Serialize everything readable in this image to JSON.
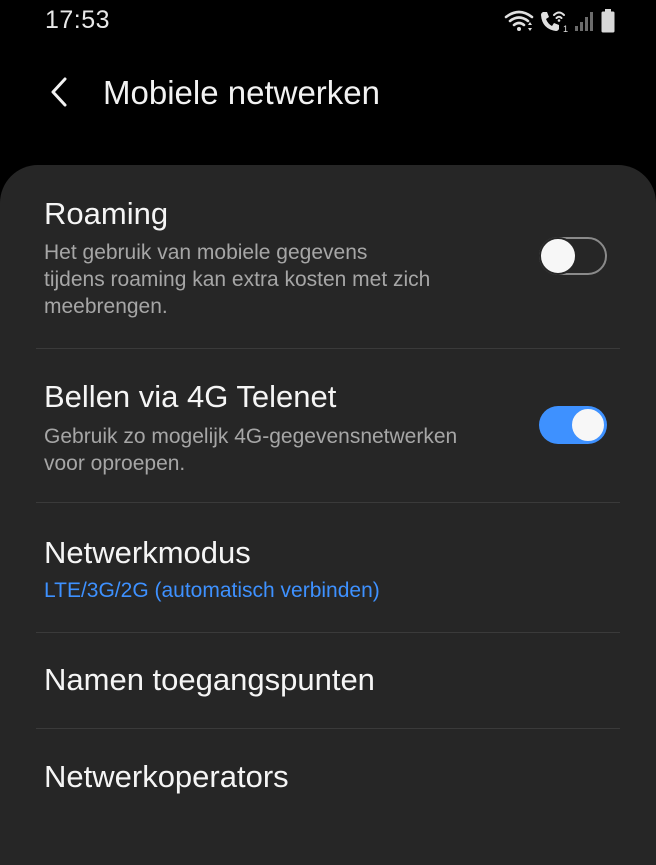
{
  "status_bar": {
    "time": "17:53",
    "icons": [
      "wifi-icon",
      "wifi-calling-icon",
      "signal-icon",
      "battery-icon"
    ],
    "sim_slot_label": "1"
  },
  "header": {
    "title": "Mobiele netwerken",
    "back_icon": "chevron-left-icon"
  },
  "settings": {
    "roaming": {
      "title": "Roaming",
      "subtitle_lines": [
        "Het gebruik van mobiele gegevens",
        "tijdens roaming kan extra kosten met zich",
        "meebrengen."
      ],
      "enabled": false
    },
    "volte": {
      "title": "Bellen via 4G Telenet",
      "subtitle_lines": [
        "Gebruik zo mogelijk 4G-gegevensnetwerken",
        "voor oproepen."
      ],
      "enabled": true
    },
    "network_mode": {
      "title": "Netwerkmodus",
      "value": "LTE/3G/2G (automatisch verbinden)"
    },
    "apn": {
      "title": "Namen toegangspunten"
    },
    "operators": {
      "title": "Netwerkoperators"
    }
  },
  "colors": {
    "background": "#000000",
    "card": "#262626",
    "accent": "#3e91ff",
    "primary_text": "#f5f5f5",
    "secondary_text": "#a6a6a6",
    "divider": "#3a3a3a"
  }
}
